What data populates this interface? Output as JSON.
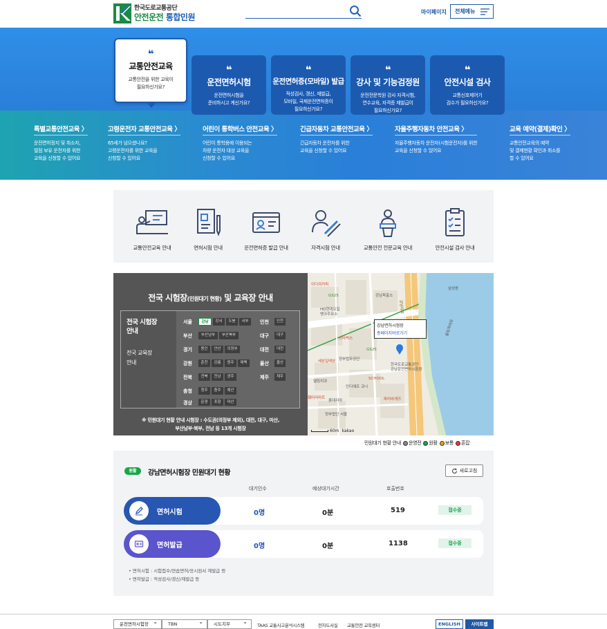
{
  "header": {
    "org_name": "한국도로교통공단",
    "service_name_green": "안전운전 ",
    "service_name_blue": "통합민원",
    "search_placeholder": "",
    "mypage": "마이페이지",
    "all_menu": "전체메뉴"
  },
  "hero": {
    "quote": "❝",
    "cards": [
      {
        "title": "교통안전교육",
        "desc": "교통안전을 위한 교육이\n필요하신가요?",
        "active": true
      },
      {
        "title": "운전면허시험",
        "desc": "운전면허시험을\n준비하시고 계신가요?"
      },
      {
        "title": "운전면허증(모바일) 발급",
        "desc": "적성검사, 갱신, 재발급,\n모바일, 국제운전면허증이\n필요하신가요?"
      },
      {
        "title": "강사 및 기능검정원",
        "desc": "운전전문학원 강사 자격시험,\n연수교육, 자격증 재발급이\n필요하신가요?"
      },
      {
        "title": "안전시설 검사",
        "desc": "교통신호제어기\n검수가 필요하신가요?"
      }
    ],
    "sub_items": [
      {
        "title": "특별교통안전교육 〉",
        "desc": "운전면허정지 및 취소자,\n벌점 보유 운전자를 위한\n교육을 신청할 수 있어요"
      },
      {
        "title": "고령운전자 교통안전교육 〉",
        "desc": "65세가 넘으셨나요?\n고령운전자를 위한 교육을\n신청할 수 있어요"
      },
      {
        "title": "어린이 통학버스 안전교육 〉",
        "desc": "어린이 통학용에 이용되는\n차량 운전자 대상 교육을\n신청할 수 있어요"
      },
      {
        "title": "긴급자동차 교통안전교육 〉",
        "desc": "긴급자동차 운전자를 위한\n교육을 신청할 수 있어요"
      },
      {
        "title": "자율주행자동차 안전교육 〉",
        "desc": "자율주행자동차 운전자(시험운전자)를 위한\n교육을 신청할 수 있어요"
      },
      {
        "title": "교육 예약(결제)확인 〉",
        "desc": "교통안전교육의 예약\n및 결제현황 확인과 취소를\n할 수 있어요"
      }
    ]
  },
  "quick_menu": [
    {
      "label": "교통안전교육 안내",
      "icon": "presentation-board-icon"
    },
    {
      "label": "면허시험 안내",
      "icon": "document-pen-icon"
    },
    {
      "label": "운전면허증 발급 안내",
      "icon": "id-card-icon"
    },
    {
      "label": "자격시험 안내",
      "icon": "person-pen-icon"
    },
    {
      "label": "교통안전 전문교육 안내",
      "icon": "podium-speaker-icon"
    },
    {
      "label": "안전시설 검사 안내",
      "icon": "checklist-clipboard-icon"
    }
  ],
  "test_center": {
    "title_a": "전국 시험장",
    "title_small": "(민원대기 현황)",
    "title_b": " 및 교육장 안내",
    "left_title": "전국 시험장\n안내",
    "left_sub": "전국 교육장\n안내",
    "rows": [
      {
        "region": "서울",
        "items": [
          "강남",
          "강서",
          "도봉",
          "서부"
        ],
        "region2": "인천",
        "items2": [
          "인천"
        ]
      },
      {
        "region": "부산",
        "items": [
          "부산남부",
          "부산북부"
        ],
        "region2": "대구",
        "items2": [
          "대구"
        ]
      },
      {
        "region": "경기",
        "items": [
          "용인",
          "안산",
          "의정부"
        ],
        "region2": "대전",
        "items2": [
          "대전"
        ]
      },
      {
        "region": "강원",
        "items": [
          "춘천",
          "강릉",
          "원주",
          "태백"
        ],
        "region2": "울산",
        "items2": [
          "울산"
        ]
      },
      {
        "region": "전북",
        "items": [
          "전북",
          "전남",
          "광주"
        ],
        "region2": "제주",
        "items2": [
          "제주"
        ]
      },
      {
        "region": "충청",
        "items": [
          "청주",
          "충주",
          "예산"
        ]
      },
      {
        "region": "경상",
        "items": [
          "문경",
          "포항",
          "마산"
        ]
      }
    ],
    "note": "※ 민원대기 현황 안내 시험장 : 수도권(의정부 제외), 대전, 대구, 마산,\n부산남부·북부, 전남 등 13개 시험장"
  },
  "map": {
    "popup_title": "강남면허시험장",
    "popup_link": "종페이지바로가기",
    "labels": [
      "강남파출소",
      "이디야커피",
      "삼성동",
      "GS25",
      "HD현대오일\n뱅크주유소",
      "스타벅스",
      "한국도로교통공단\n강남운전면허시험장",
      "세븐일레븐",
      "정부법무공단",
      "GS25",
      "인디애프 코너",
      "훼미리마트",
      "올림픽대로",
      "엘림치과",
      "파리바게뜨",
      "롯데리아",
      "SCHOOL",
      "정부법인 서울",
      "강남대로"
    ],
    "scale": "60m",
    "copyright": "kakao",
    "legend_title": "민원대기 현황 안내",
    "legend": [
      {
        "label": "운영전",
        "color": "#888888"
      },
      {
        "label": "원활",
        "color": "#19a54a"
      },
      {
        "label": "보통",
        "color": "#f29b1a"
      },
      {
        "label": "혼잡",
        "color": "#e23b3b"
      }
    ]
  },
  "wait_status": {
    "badge": "원활",
    "title": "강남면허시험장 민원대기 현황",
    "refresh": "새로고침",
    "headers": [
      "대기인수",
      "예상대기시간",
      "호출번호"
    ],
    "rows": [
      {
        "label": "면허시험",
        "color": "#2756b3",
        "icon": "pen-icon",
        "waiting": "0명",
        "time": "0분",
        "call": "519",
        "status": "접수중"
      },
      {
        "label": "면허발급",
        "color": "#5a55cc",
        "icon": "id-card-icon",
        "waiting": "0명",
        "time": "0분",
        "call": "1138",
        "status": "접수중"
      }
    ],
    "notes": [
      "• 면허시험 : 시험접수/연습면허/응시원서 재발급 등",
      "• 면허발급 : 적성검사/갱신/재발급 등"
    ]
  },
  "footer": {
    "selects": [
      "운전면허시험장",
      "TBN",
      "시도지부"
    ],
    "links": [
      "TAAS 교통사고분석시스템",
      "전자도서실",
      "교통안전 교육센터"
    ],
    "english": "ENGLISH",
    "sitemap": "사이트맵"
  }
}
